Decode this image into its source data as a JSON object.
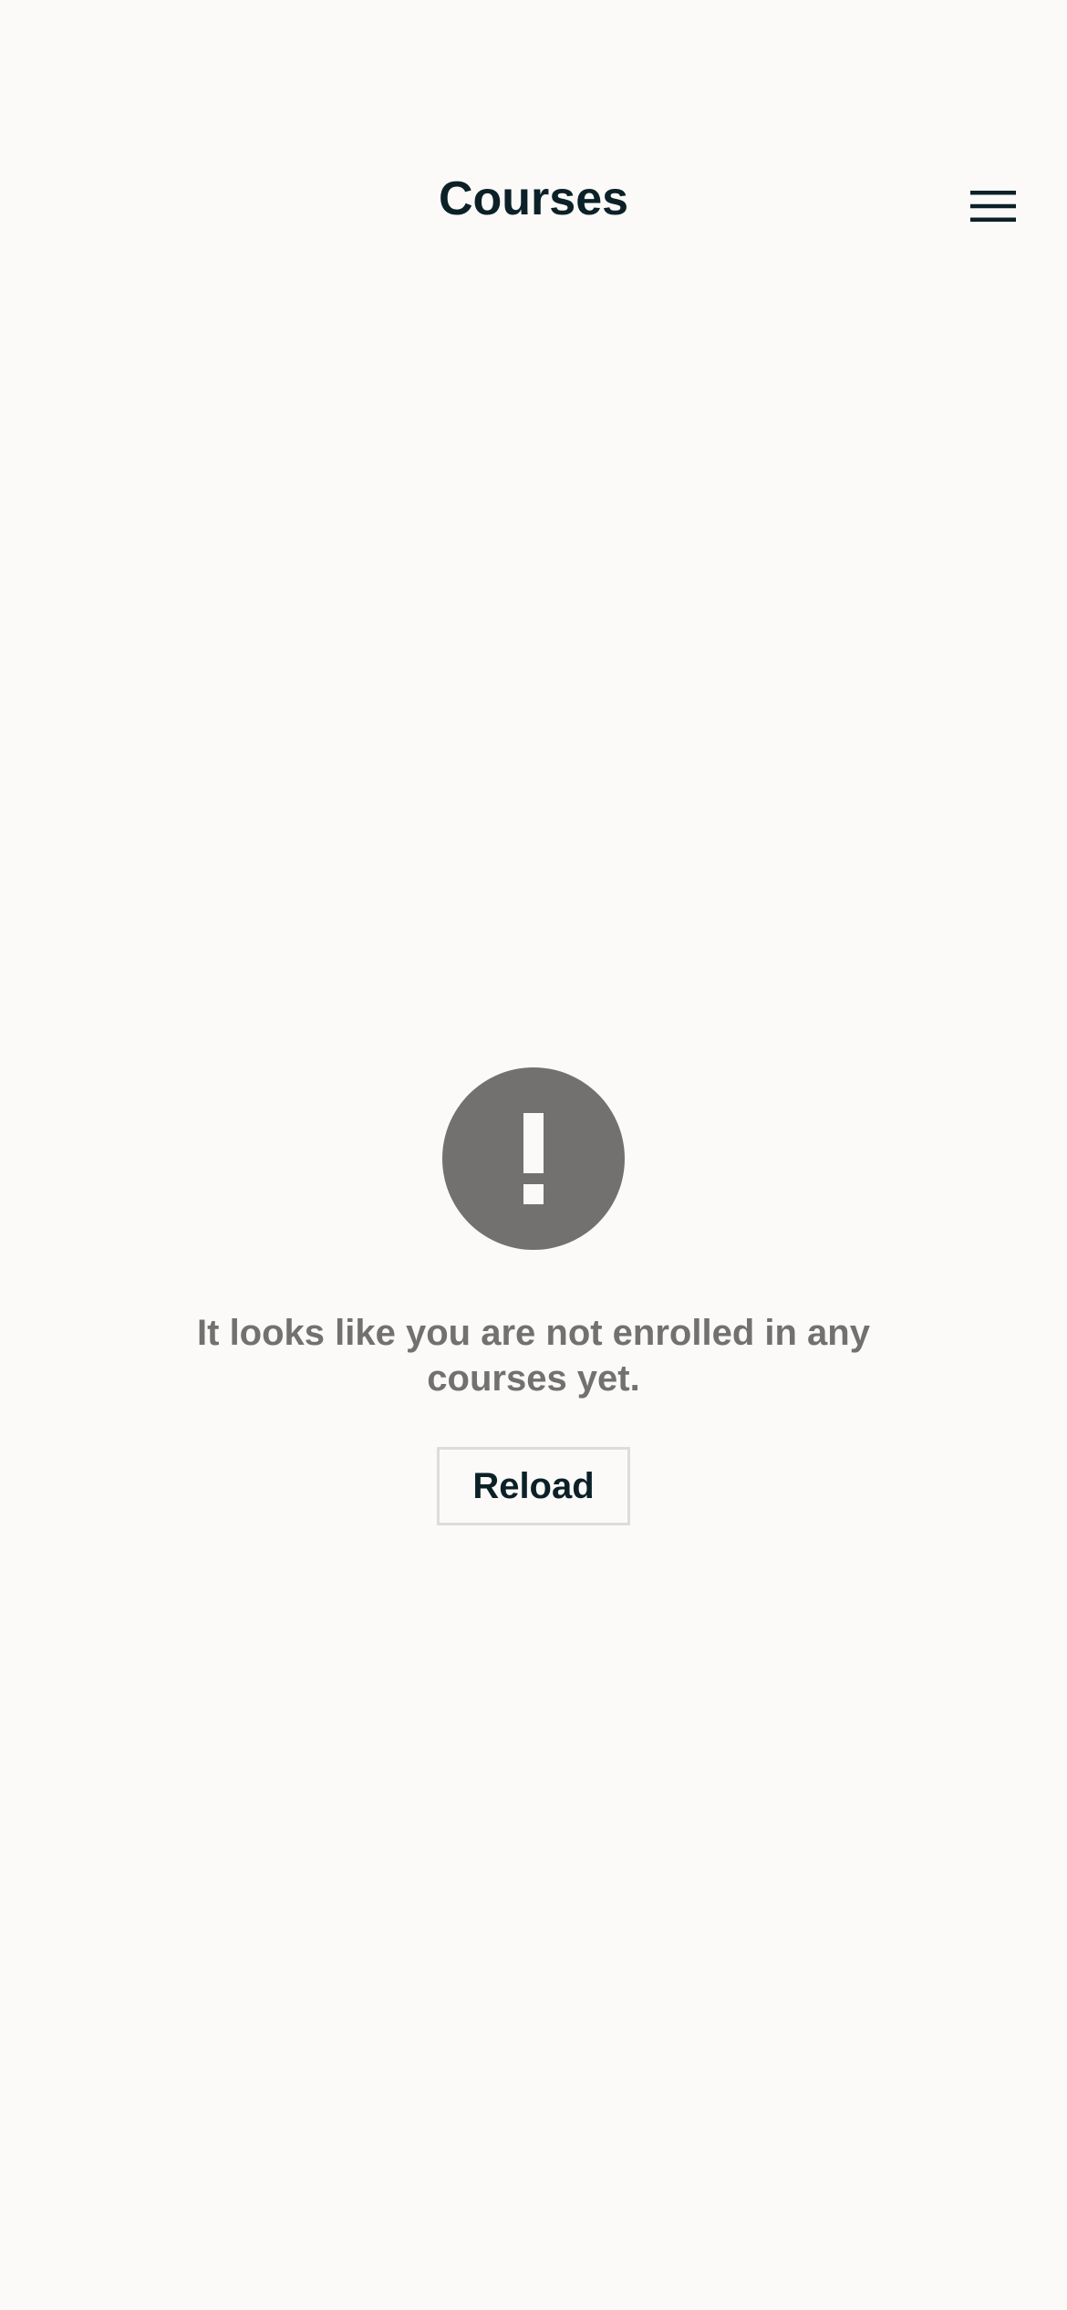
{
  "header": {
    "title": "Courses",
    "menu_icon": "hamburger-menu-icon"
  },
  "empty_state": {
    "icon": "alert-circle-icon",
    "message": "It looks like you are not enrolled in any courses yet.",
    "reload_label": "Reload"
  },
  "colors": {
    "background": "#fbfaf9",
    "title_text": "#0b2127",
    "icon_fill": "#727170",
    "message_text": "#727170",
    "button_border": "#dddcdb"
  }
}
